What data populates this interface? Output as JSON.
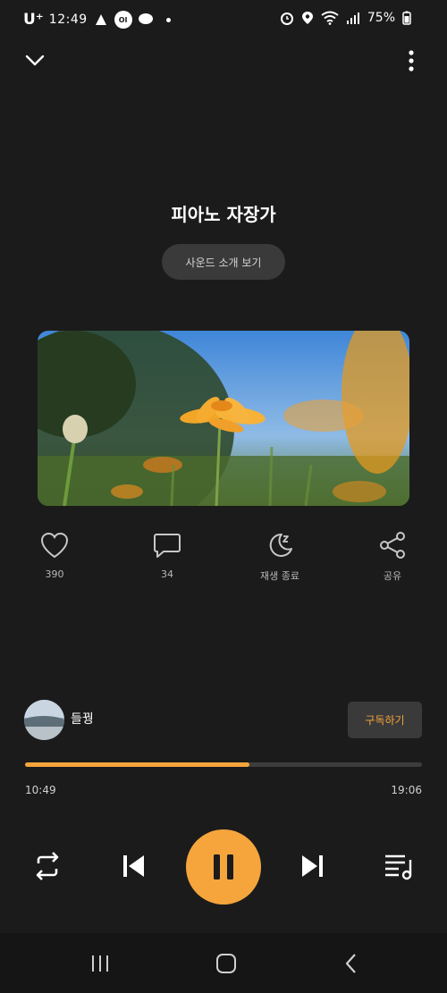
{
  "status_bar": {
    "carrier": "U⁺",
    "time": "12:49",
    "battery": "75%"
  },
  "track": {
    "title": "피아노 자장가",
    "intro_label": "사운드 소개 보기"
  },
  "actions": {
    "like_count": "390",
    "comment_count": "34",
    "sleep_label": "재생 종료",
    "share_label": "공유"
  },
  "channel": {
    "name": "들꿩",
    "subscribe_label": "구독하기"
  },
  "playback": {
    "current_time": "10:49",
    "total_time": "19:06",
    "progress": 0.566
  },
  "colors": {
    "accent": "#f5a53c",
    "background": "#1b1b1b"
  },
  "icons": [
    "chevron-down-icon",
    "more-vert-icon",
    "heart-icon",
    "comment-icon",
    "moon-sleep-icon",
    "share-icon",
    "repeat-icon",
    "previous-icon",
    "pause-icon",
    "next-icon",
    "playlist-icon",
    "recents-icon",
    "home-icon",
    "back-icon"
  ]
}
